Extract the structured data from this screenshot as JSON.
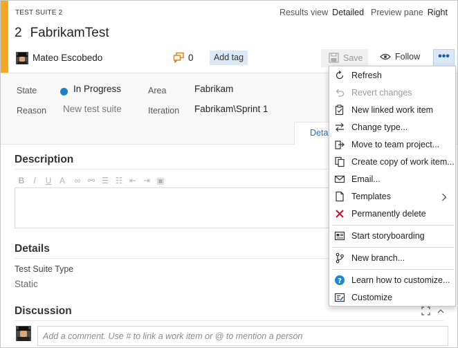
{
  "header": {
    "type_label": "TEST SUITE 2",
    "results_view_label": "Results view",
    "results_view_value": "Detailed",
    "preview_pane_label": "Preview pane",
    "preview_pane_value": "Right",
    "work_item_id": "2",
    "title": "FabrikamTest",
    "assignee": "Mateo Escobedo",
    "comment_count": "0",
    "add_tag_label": "Add tag",
    "save_label": "Save",
    "follow_label": "Follow",
    "more_label": "•••",
    "accent_color": "#f5a623"
  },
  "fields": {
    "state_label": "State",
    "state_value": "In Progress",
    "state_color": "#1a7fd0",
    "area_label": "Area",
    "area_value": "Fabrikam",
    "reason_label": "Reason",
    "reason_value": "New test suite",
    "iteration_label": "Iteration",
    "iteration_value": "Fabrikam\\Sprint 1",
    "details_tab_label": "Deta"
  },
  "description": {
    "heading": "Description",
    "toolbar_icons": [
      "bold-icon",
      "italic-icon",
      "underline-icon",
      "highlight-icon",
      "link-icon",
      "unlink-icon",
      "bullet-list-icon",
      "numbered-list-icon",
      "outdent-icon",
      "indent-icon",
      "image-icon"
    ]
  },
  "details": {
    "heading": "Details",
    "test_suite_type_label": "Test Suite Type",
    "test_suite_type_value": "Static"
  },
  "discussion": {
    "heading": "Discussion",
    "comment_placeholder": "Add a comment. Use # to link a work item or @ to mention a person"
  },
  "menu": {
    "items": [
      {
        "label": "Refresh",
        "icon": "refresh-icon"
      },
      {
        "label": "Revert changes",
        "icon": "undo-icon"
      },
      {
        "label": "New linked work item",
        "icon": "clipboard-icon"
      },
      {
        "label": "Change type...",
        "icon": "swap-icon"
      },
      {
        "label": "Move to team project...",
        "icon": "move-icon"
      },
      {
        "label": "Create copy of work item...",
        "icon": "copy-icon"
      },
      {
        "label": "Email...",
        "icon": "mail-icon"
      },
      {
        "label": "Templates",
        "icon": "template-icon"
      },
      {
        "label": "Permanently delete",
        "icon": "delete-x-icon"
      },
      {
        "label": "Start storyboarding",
        "icon": "storyboard-icon"
      },
      {
        "label": "New branch...",
        "icon": "branch-icon"
      },
      {
        "label": "Learn how to customize...",
        "icon": "help-icon"
      },
      {
        "label": "Customize",
        "icon": "customize-icon"
      }
    ]
  }
}
